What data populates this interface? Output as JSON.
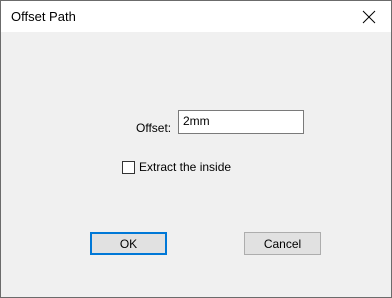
{
  "window": {
    "title": "Offset Path",
    "close_icon": "close-icon"
  },
  "form": {
    "offset_label": "Offset:",
    "offset_value": "2mm",
    "extract_inside_label": "Extract the inside",
    "extract_inside_checked": false
  },
  "buttons": {
    "ok_label": "OK",
    "cancel_label": "Cancel"
  },
  "colors": {
    "dialog_background": "#f0f0f0",
    "titlebar_background": "#ffffff",
    "default_button_border": "#0078d7"
  }
}
